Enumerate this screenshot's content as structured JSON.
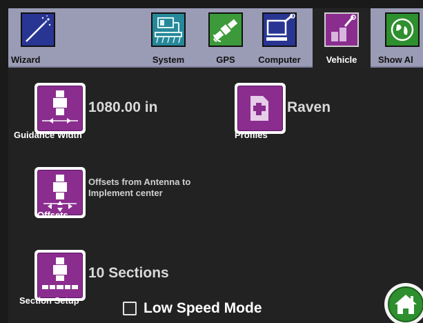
{
  "tabs": [
    {
      "label": "Wizard",
      "icon": "wizard-wand-icon",
      "color": "#283593"
    },
    {
      "label": "System",
      "icon": "system-field-icon",
      "color": "#27889a"
    },
    {
      "label": "GPS",
      "icon": "gps-satellite-icon",
      "color": "#3d9a3a"
    },
    {
      "label": "Computer",
      "icon": "computer-icon",
      "color": "#283593"
    },
    {
      "label": "Vehicle",
      "icon": "vehicle-tools-icon",
      "color": "#8a2d8f",
      "active": true
    },
    {
      "label": "Show Al",
      "icon": "globe-icon",
      "color": "#2e8f2e"
    }
  ],
  "vehicle": {
    "guidance": {
      "caption": "Guidance Width",
      "value": "1080.00 in",
      "icon": "guidance-width-icon"
    },
    "profiles": {
      "caption": "Profiles",
      "value": "Raven",
      "icon": "profiles-icon"
    },
    "offsets": {
      "caption": "Offsets",
      "desc_line1": "Offsets from Antenna to",
      "desc_line2": "Implement center",
      "icon": "offsets-icon"
    },
    "sections": {
      "caption": "Section Setup",
      "value": "10 Sections",
      "icon": "section-setup-icon"
    }
  },
  "low_speed": {
    "label": "Low Speed Mode",
    "checked": false
  },
  "home": {
    "icon": "home-icon"
  },
  "colors": {
    "accent": "#8a2d8f",
    "tabbar": "#9a9bb5",
    "background": "#222222",
    "home": "#2e8f2e"
  }
}
